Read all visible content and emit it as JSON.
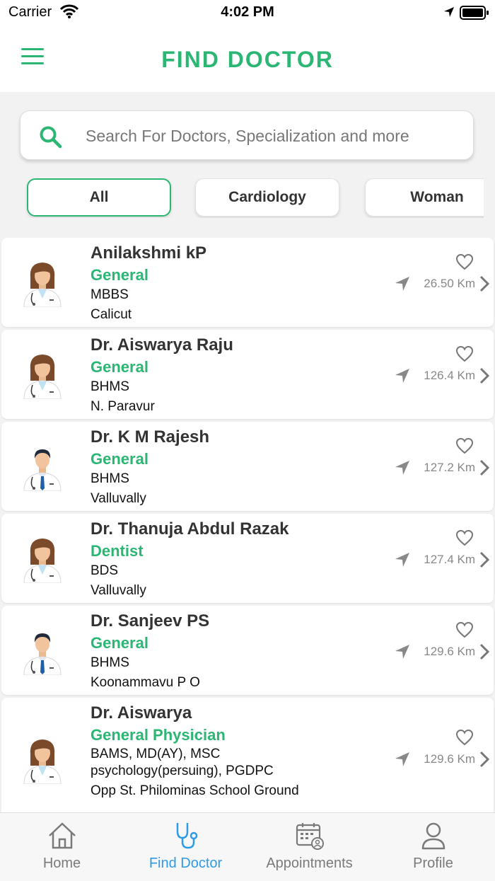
{
  "status_bar": {
    "carrier": "Carrier",
    "time": "4:02 PM"
  },
  "header": {
    "title": "FIND DOCTOR"
  },
  "search": {
    "placeholder": "Search For Doctors, Specialization and more"
  },
  "filters": [
    {
      "label": "All",
      "selected": true
    },
    {
      "label": "Cardiology",
      "selected": false
    },
    {
      "label": "Woman",
      "selected": false
    }
  ],
  "doctors": [
    {
      "name": "Anilakshmi kP",
      "specialization": "General",
      "qualification": "MBBS",
      "location": "Calicut",
      "distance": "26.50 Km",
      "avatar": "female-doctor-icon"
    },
    {
      "name": "Dr. Aiswarya Raju",
      "specialization": "General",
      "qualification": "BHMS",
      "location": "N. Paravur",
      "distance": "126.4 Km",
      "avatar": "female-doctor-icon"
    },
    {
      "name": "Dr. K M Rajesh",
      "specialization": "General",
      "qualification": "BHMS",
      "location": "Valluvally",
      "distance": "127.2 Km",
      "avatar": "male-doctor-icon"
    },
    {
      "name": "Dr. Thanuja Abdul Razak",
      "specialization": "Dentist",
      "qualification": "BDS",
      "location": "Valluvally",
      "distance": "127.4 Km",
      "avatar": "female-doctor-icon"
    },
    {
      "name": "Dr. Sanjeev PS",
      "specialization": "General",
      "qualification": "BHMS",
      "location": "Koonammavu P O",
      "distance": "129.6 Km",
      "avatar": "male-doctor-icon"
    },
    {
      "name": "Dr. Aiswarya",
      "specialization": "General Physician",
      "qualification": "BAMS, MD(AY), MSC psychology(persuing), PGDPC",
      "location": "Opp St. Philominas School Ground",
      "distance": "129.6 Km",
      "avatar": "female-doctor-icon"
    }
  ],
  "tab_bar": [
    {
      "label": "Home",
      "icon": "home-icon",
      "active": false
    },
    {
      "label": "Find Doctor",
      "icon": "stethoscope-icon",
      "active": true
    },
    {
      "label": "Appointments",
      "icon": "calendar-icon",
      "active": false
    },
    {
      "label": "Profile",
      "icon": "user-icon",
      "active": false
    }
  ],
  "colors": {
    "accent": "#2bb673",
    "tab_active": "#2e9be6",
    "tab_inactive": "#7a7a7a",
    "muted": "#888888"
  }
}
